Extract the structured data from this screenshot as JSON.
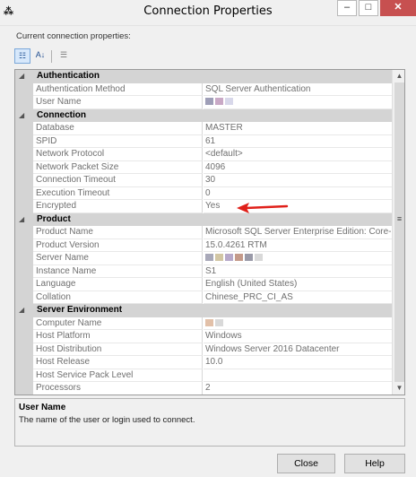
{
  "window": {
    "title": "Connection Properties",
    "app_icon": "vs-icon",
    "min_glyph": "–",
    "max_glyph": "□",
    "close_glyph": "✕"
  },
  "subtitle": "Current connection properties:",
  "toolbar": {
    "categorized_glyph": "☷",
    "alphabetical_glyph": "A↓",
    "pages_glyph": "☰"
  },
  "grid": {
    "collapse_glyph": "◢",
    "categories": [
      {
        "label": "Authentication",
        "props": [
          {
            "name": "Authentication Method",
            "value": "SQL Server Authentication"
          },
          {
            "name": "User Name",
            "value": "",
            "redacted": [
              "#9f9fb8",
              "#c9a9c6",
              "#d8d8ea"
            ]
          }
        ]
      },
      {
        "label": "Connection",
        "props": [
          {
            "name": "Database",
            "value": "MASTER"
          },
          {
            "name": "SPID",
            "value": "61"
          },
          {
            "name": "Network Protocol",
            "value": "<default>"
          },
          {
            "name": "Network Packet Size",
            "value": "4096"
          },
          {
            "name": "Connection Timeout",
            "value": "30"
          },
          {
            "name": "Execution Timeout",
            "value": "0"
          },
          {
            "name": "Encrypted",
            "value": "Yes"
          }
        ]
      },
      {
        "label": "Product",
        "props": [
          {
            "name": "Product Name",
            "value": "Microsoft SQL Server Enterprise Edition: Core-ba"
          },
          {
            "name": "Product Version",
            "value": "15.0.4261 RTM"
          },
          {
            "name": "Server Name",
            "value": "",
            "redacted": [
              "#a9a9b9",
              "#d2c6a4",
              "#b7a9c9",
              "#c49a8a",
              "#9a9aa8",
              "#d9d9d9"
            ]
          },
          {
            "name": "Instance Name",
            "value": "S1"
          },
          {
            "name": "Language",
            "value": "English (United States)"
          },
          {
            "name": "Collation",
            "value": "Chinese_PRC_CI_AS"
          }
        ]
      },
      {
        "label": "Server Environment",
        "props": [
          {
            "name": "Computer Name",
            "value": "",
            "redacted": [
              "#e2c0a8",
              "#d9d9d9"
            ]
          },
          {
            "name": "Host Platform",
            "value": "Windows"
          },
          {
            "name": "Host Distribution",
            "value": "Windows Server 2016 Datacenter"
          },
          {
            "name": "Host Release",
            "value": "10.0"
          },
          {
            "name": "Host Service Pack Level",
            "value": ""
          },
          {
            "name": "Processors",
            "value": "2"
          }
        ]
      }
    ]
  },
  "scrollbar": {
    "up_glyph": "▲",
    "down_glyph": "▼",
    "grip_glyph": "≡"
  },
  "annotation": {
    "color": "#e0201a"
  },
  "description": {
    "title": "User Name",
    "text": "The name of the user or login used to connect."
  },
  "buttons": {
    "close": "Close",
    "help": "Help"
  }
}
